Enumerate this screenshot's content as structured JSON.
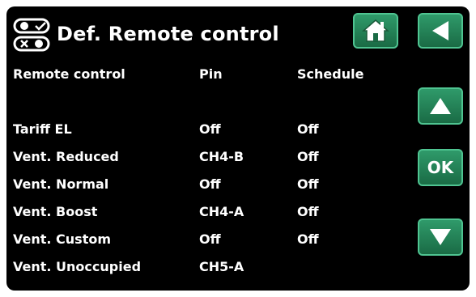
{
  "title": "Def. Remote control",
  "icons": {
    "mode": "remote-toggle-icon",
    "home": "home-icon",
    "back": "back-arrow-icon",
    "up": "up-arrow-icon",
    "down": "down-arrow-icon"
  },
  "buttons": {
    "ok": "OK"
  },
  "table": {
    "headers": [
      "Remote control",
      "Pin",
      "Schedule"
    ],
    "rows": [
      [
        "Tariff EL",
        "Off",
        "Off"
      ],
      [
        "Vent. Reduced",
        "CH4-B",
        "Off"
      ],
      [
        "Vent. Normal",
        "Off",
        "Off"
      ],
      [
        "Vent. Boost",
        "CH4-A",
        "Off"
      ],
      [
        "Vent. Custom",
        "Off",
        "Off"
      ],
      [
        "Vent. Unoccupied",
        "CH5-A",
        ""
      ]
    ]
  },
  "colors": {
    "background": "#000000",
    "accent": "#2f9a6a",
    "text": "#ffffff"
  }
}
